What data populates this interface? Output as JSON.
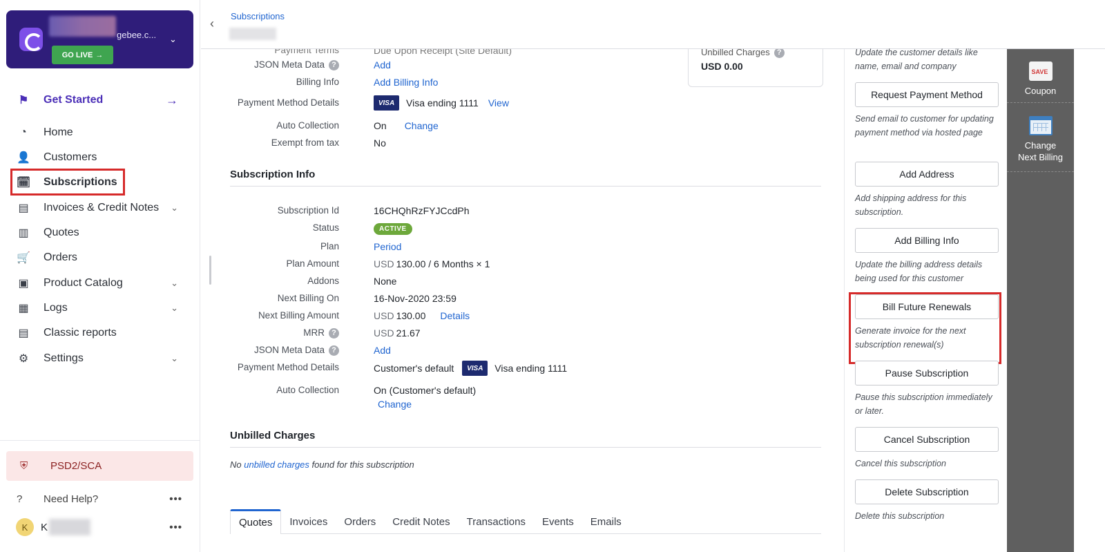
{
  "sidebar": {
    "brand": {
      "name_suffix": "gebee.c...",
      "go_live": "GO LIVE"
    },
    "get_started": "Get Started",
    "items": [
      {
        "label": "Home",
        "icon": "dashboard-icon"
      },
      {
        "label": "Customers",
        "icon": "customers-icon"
      },
      {
        "label": "Subscriptions",
        "icon": "subscriptions-icon"
      },
      {
        "label": "Invoices & Credit Notes",
        "icon": "invoice-icon"
      },
      {
        "label": "Quotes",
        "icon": "quotes-icon"
      },
      {
        "label": "Orders",
        "icon": "cart-icon"
      },
      {
        "label": "Product Catalog",
        "icon": "catalog-icon"
      },
      {
        "label": "Logs",
        "icon": "logs-icon"
      },
      {
        "label": "Classic reports",
        "icon": "reports-icon"
      },
      {
        "label": "Settings",
        "icon": "gear-icon"
      }
    ],
    "psd2": "PSD2/SCA",
    "help": "Need Help?",
    "user_initial": "K",
    "user_name_start": "K"
  },
  "header": {
    "breadcrumb": "Subscriptions"
  },
  "customer_section": {
    "cut_label": "Payment Terms",
    "cut_value": "Due Upon Receipt (Site Default)",
    "json_label": "JSON Meta Data",
    "json_value": "Add",
    "billing_label": "Billing Info",
    "billing_value": "Add Billing Info",
    "pm_label": "Payment Method Details",
    "pm_card": "Visa ending 1111",
    "pm_view": "View",
    "auto_label": "Auto Collection",
    "auto_value": "On",
    "auto_change": "Change",
    "exempt_label": "Exempt from tax",
    "exempt_value": "No",
    "unbilled_label": "Unbilled Charges",
    "unbilled_value": "USD 0.00"
  },
  "subscription_info": {
    "title": "Subscription Info",
    "id_label": "Subscription Id",
    "id_value": "16CHQhRzFYJCcdPh",
    "status_label": "Status",
    "status_value": "ACTIVE",
    "plan_label": "Plan",
    "plan_value": "Period",
    "amount_label": "Plan Amount",
    "amount_currency": "USD",
    "amount_value": "130.00 / 6 Months × 1",
    "addons_label": "Addons",
    "addons_value": "None",
    "next_on_label": "Next Billing On",
    "next_on_value": "16-Nov-2020 23:59",
    "next_amt_label": "Next Billing Amount",
    "next_amt_currency": "USD",
    "next_amt_value": "130.00",
    "next_amt_details": "Details",
    "mrr_label": "MRR",
    "mrr_currency": "USD",
    "mrr_value": "21.67",
    "json_label": "JSON Meta Data",
    "json_value": "Add",
    "pm_label": "Payment Method Details",
    "pm_default": "Customer's default",
    "pm_card": "Visa ending 1111",
    "auto_label": "Auto Collection",
    "auto_value": "On (Customer's default)",
    "auto_change": "Change"
  },
  "unbilled": {
    "title": "Unbilled Charges",
    "empty_prefix": "No ",
    "empty_link": "unbilled charges",
    "empty_suffix": " found for this subscription"
  },
  "tabs": [
    "Quotes",
    "Invoices",
    "Orders",
    "Credit Notes",
    "Transactions",
    "Events",
    "Emails"
  ],
  "visa_text": "VISA",
  "actions": {
    "top_desc": "Update the customer details like name, email and company",
    "items": [
      {
        "label": "Request Payment Method",
        "desc": "Send email to customer for updating payment method via hosted page"
      },
      {
        "label": "Add Address",
        "desc": "Add shipping address for this subscription."
      },
      {
        "label": "Add Billing Info",
        "desc": "Update the billing address details being used for this customer"
      },
      {
        "label": "Bill Future Renewals",
        "desc": "Generate invoice for the next subscription renewal(s)"
      },
      {
        "label": "Pause Subscription",
        "desc": "Pause this subscription immediately or later."
      },
      {
        "label": "Cancel Subscription",
        "desc": "Cancel this subscription"
      },
      {
        "label": "Delete Subscription",
        "desc": "Delete this subscription"
      }
    ]
  },
  "rail": {
    "coupon": "Coupon",
    "change_next_billing": "Change Next Billing"
  },
  "colors": {
    "brand": "#2f1d7a",
    "accent": "#2065d0",
    "highlight": "#d62a2a",
    "active": "#6da83b"
  }
}
